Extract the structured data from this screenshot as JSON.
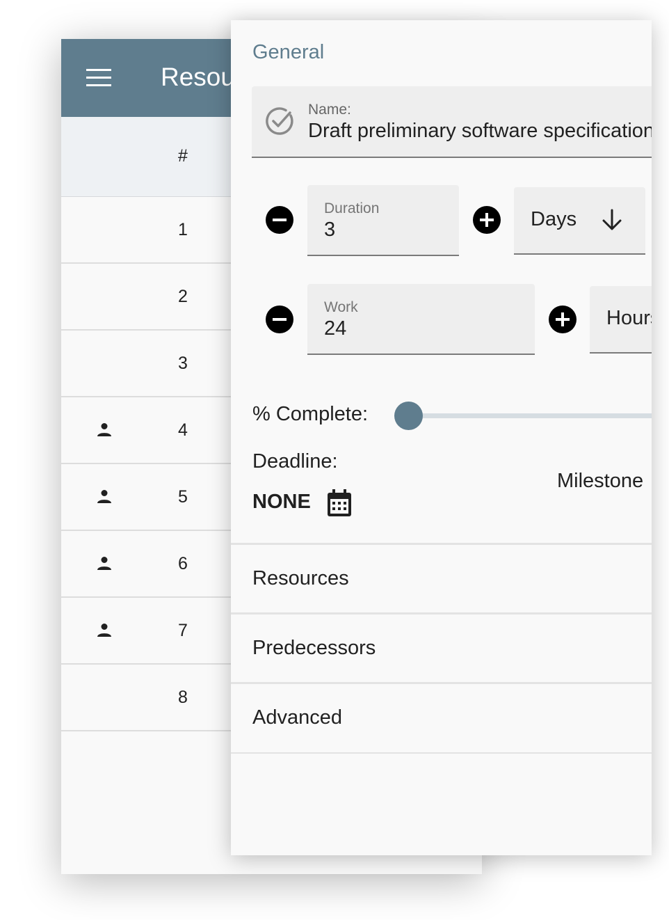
{
  "back_window": {
    "title": "Resources",
    "column_header": "#",
    "rows": [
      {
        "num": "1",
        "has_person": false
      },
      {
        "num": "2",
        "has_person": false
      },
      {
        "num": "3",
        "has_person": false
      },
      {
        "num": "4",
        "has_person": true
      },
      {
        "num": "5",
        "has_person": true
      },
      {
        "num": "6",
        "has_person": true
      },
      {
        "num": "7",
        "has_person": true
      },
      {
        "num": "8",
        "has_person": false
      }
    ]
  },
  "panel": {
    "header": "General",
    "name": {
      "label": "Name:",
      "value": "Draft preliminary software specifications"
    },
    "duration": {
      "label": "Duration",
      "value": "3",
      "unit": "Days"
    },
    "work": {
      "label": "Work",
      "value": "24",
      "unit": "Hours"
    },
    "complete": {
      "label": "% Complete:",
      "value_percent": 0
    },
    "deadline": {
      "label": "Deadline:",
      "value": "NONE"
    },
    "milestone_label": "Milestone",
    "sections": {
      "resources": "Resources",
      "predecessors": "Predecessors",
      "advanced": "Advanced"
    }
  },
  "icons": {
    "menu": "menu-icon",
    "person": "person-icon",
    "check": "check-circle-icon",
    "minus": "minus-circle-icon",
    "plus": "plus-circle-icon",
    "arrow": "arrow-down-icon",
    "calendar": "calendar-icon"
  },
  "colors": {
    "accent": "#5f7d8e",
    "header_bg": "#5f7d8e",
    "slider_track": "#d6dde2"
  }
}
